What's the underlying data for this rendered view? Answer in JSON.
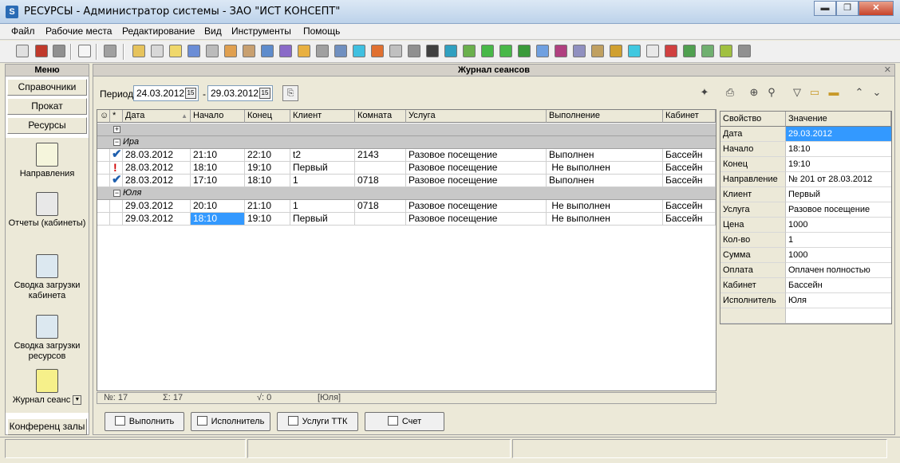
{
  "window": {
    "icon_letter": "S",
    "title": "РЕСУРСЫ - Администратор системы  - ЗАО \"ИСТ КОНСЕПТ\"",
    "minimize": "▬",
    "maximize": "❐",
    "close": "✕"
  },
  "menubar": [
    "Файл",
    "Рабочие места",
    "Редактирование",
    "Вид",
    "Инструменты",
    "Помощь"
  ],
  "sidebar": {
    "title": "Меню",
    "buttons": [
      "Справочники",
      "Прокат",
      "Ресурсы"
    ],
    "items": [
      "Направления",
      "Отчеты (кабинеты)",
      "Сводка загрузки кабинета",
      "Сводка загрузки ресурсов",
      "Журнал сеанс"
    ],
    "bottom_button": "Конференц залы",
    "dropdown_glyph": "▼"
  },
  "panel": {
    "title": "Журнал сеансов",
    "close_glyph": "✕",
    "period_label": "Период",
    "date_from": "24.03.2012",
    "date_sep": "-",
    "date_to": "29.03.2012",
    "cal_glyph": "15"
  },
  "grid": {
    "columns": [
      "☺",
      "*",
      "Дата",
      "Начало",
      "Конец",
      "Клиент",
      "Комната",
      "Услуга",
      "Выполнение",
      "Кабинет"
    ],
    "sort_glyph": "▲",
    "expand_glyph": "+",
    "collapse_glyph": "−",
    "groups": [
      {
        "name": "Ира",
        "rows": [
          [
            "✔",
            "28.03.2012",
            "21:10",
            "22:10",
            "t2",
            "2143",
            "Разовое посещение",
            "Выполнен",
            "Бассейн"
          ],
          [
            "!",
            "28.03.2012",
            "18:10",
            "19:10",
            "Первый",
            "",
            "Разовое посещение",
            " Не выполнен",
            "Бассейн"
          ],
          [
            "✔",
            "28.03.2012",
            "17:10",
            "18:10",
            "1",
            "0718",
            "Разовое посещение",
            "Выполнен",
            "Бассейн"
          ]
        ]
      },
      {
        "name": "Юля",
        "rows": [
          [
            "",
            "29.03.2012",
            "20:10",
            "21:10",
            "1",
            "0718",
            "Разовое посещение",
            " Не выполнен",
            "Бассейн"
          ],
          [
            "",
            "29.03.2012",
            "18:10",
            "19:10",
            "Первый",
            "",
            "Разовое посещение",
            " Не выполнен",
            "Бассейн"
          ]
        ]
      }
    ],
    "footer": {
      "count": "№: 17",
      "sum": "Σ:  17",
      "sqrt": "√:  0",
      "group": "[Юля]"
    }
  },
  "properties": {
    "headers": [
      "Свойство",
      "Значение"
    ],
    "rows": [
      [
        "Дата",
        "29.03.2012"
      ],
      [
        "Начало",
        "18:10"
      ],
      [
        "Конец",
        "19:10"
      ],
      [
        "Направление",
        "№ 201 от 28.03.2012"
      ],
      [
        "Клиент",
        "Первый"
      ],
      [
        "Услуга",
        "Разовое посещение"
      ],
      [
        "Цена",
        "1000"
      ],
      [
        "Кол-во",
        "1"
      ],
      [
        "Сумма",
        "1000"
      ],
      [
        "Оплата",
        "Оплачен полностью"
      ],
      [
        "Кабинет",
        "Бассейн"
      ],
      [
        "Исполнитель",
        "Юля"
      ]
    ]
  },
  "actions": [
    "Выполнить",
    "Исполнитель",
    "Услуги ТТК",
    "Счет"
  ],
  "toolbar_icons": [
    "session-print-icon",
    "print-icon",
    "zoom-in-icon",
    "search-icon",
    "filter-icon",
    "folder-open-icon",
    "folder-icon",
    "expand-all-icon",
    "collapse-all-icon"
  ],
  "colors": {
    "selection": "#3399ff",
    "group_row": "#c8c8c8",
    "check": "#1e5fae",
    "alert": "#d00000"
  }
}
